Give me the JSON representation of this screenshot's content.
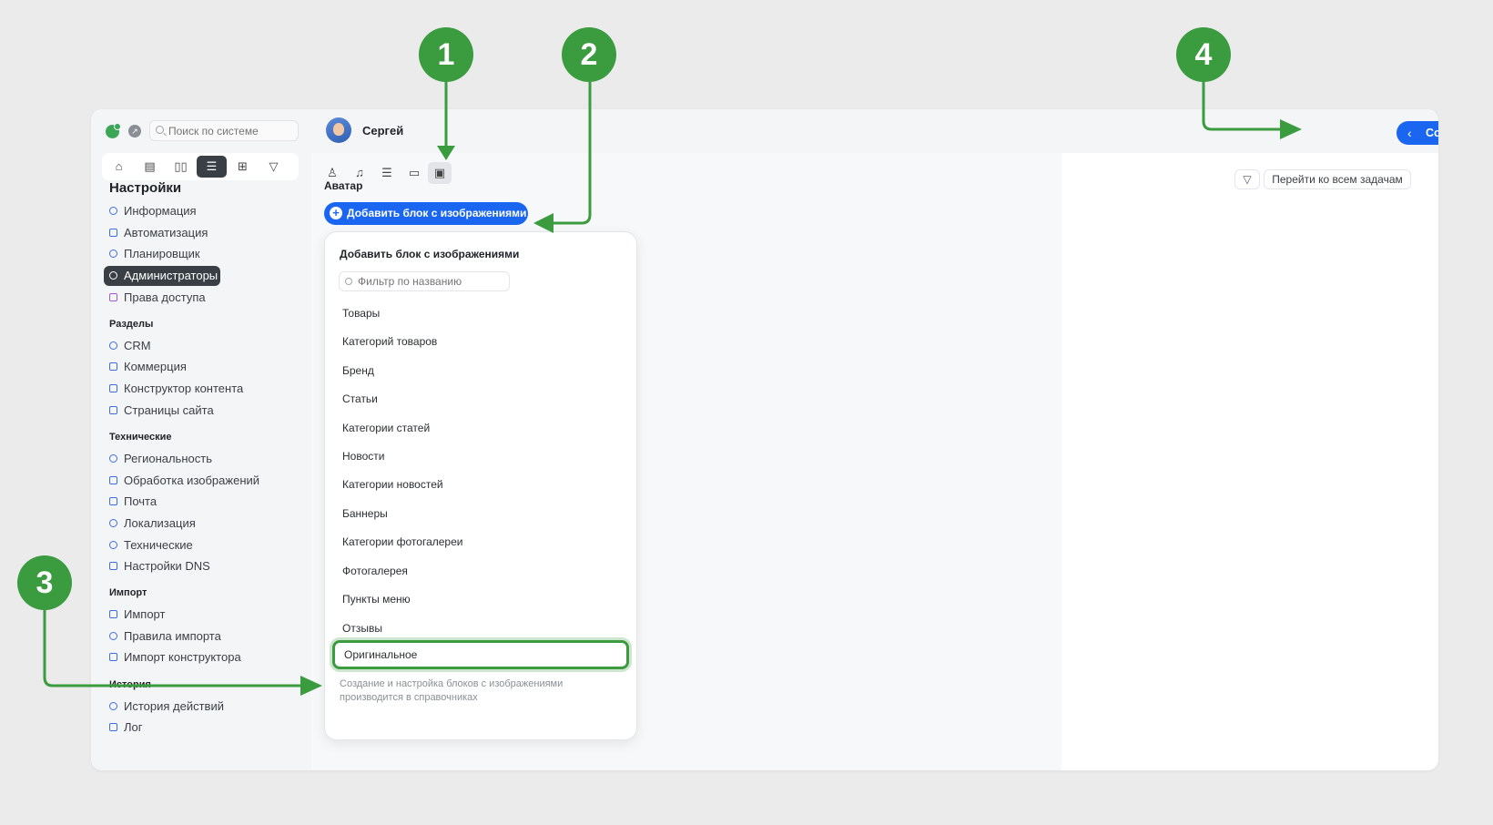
{
  "app": {
    "search_placeholder": "Поиск по системе",
    "user_name": "Сергей",
    "save_label": "Сохранить"
  },
  "module_tabs": [
    {
      "icon": "crm-icon"
    },
    {
      "icon": "commerce-icon"
    },
    {
      "icon": "book-icon"
    },
    {
      "icon": "settings-sliders-icon",
      "active": true
    },
    {
      "icon": "add-square-icon"
    },
    {
      "icon": "brush-icon"
    }
  ],
  "sidebar": {
    "title": "Настройки",
    "items_main": [
      "Информация",
      "Автоматизация",
      "Планировщик",
      "Администраторы",
      "Права доступа"
    ],
    "section_sections": "Разделы",
    "items_sections": [
      "CRM",
      "Коммерция",
      "Конструктор контента",
      "Страницы сайта"
    ],
    "section_tech": "Технические",
    "items_tech": [
      "Региональность",
      "Обработка изображений",
      "Почта",
      "Локализация",
      "Технические",
      "Настройки DNS"
    ],
    "section_import": "Импорт",
    "items_import": [
      "Импорт",
      "Правила импорта",
      "Импорт конструктора"
    ],
    "section_history": "История",
    "items_history": [
      "История действий",
      "Лог"
    ]
  },
  "content": {
    "section_label": "Аватар",
    "add_block_label": "Добавить блок с изображениями",
    "tab_icons": [
      "user-icon",
      "bell-icon",
      "list-icon",
      "monitor-icon",
      "image-icon"
    ]
  },
  "dropdown": {
    "title": "Добавить блок с изображениями",
    "filter_placeholder": "Фильтр по названию",
    "items": [
      "Товары",
      "Категорий товаров",
      "Бренд",
      "Статьи",
      "Категории статей",
      "Новости",
      "Категории новостей",
      "Баннеры",
      "Категории фотогалереи",
      "Фотогалерея",
      "Пункты меню",
      "Отзывы",
      "Оригинальное"
    ],
    "note": "Создание и настройка блоков с изображениями производится в справочниках"
  },
  "right_panel": {
    "tasks_label": "Перейти ко всем задачам"
  },
  "callouts": [
    "1",
    "2",
    "3",
    "4"
  ],
  "colors": {
    "accent": "#1a66f0",
    "callout": "#3a9b3f",
    "sidebar_active": "#3a3f46"
  }
}
